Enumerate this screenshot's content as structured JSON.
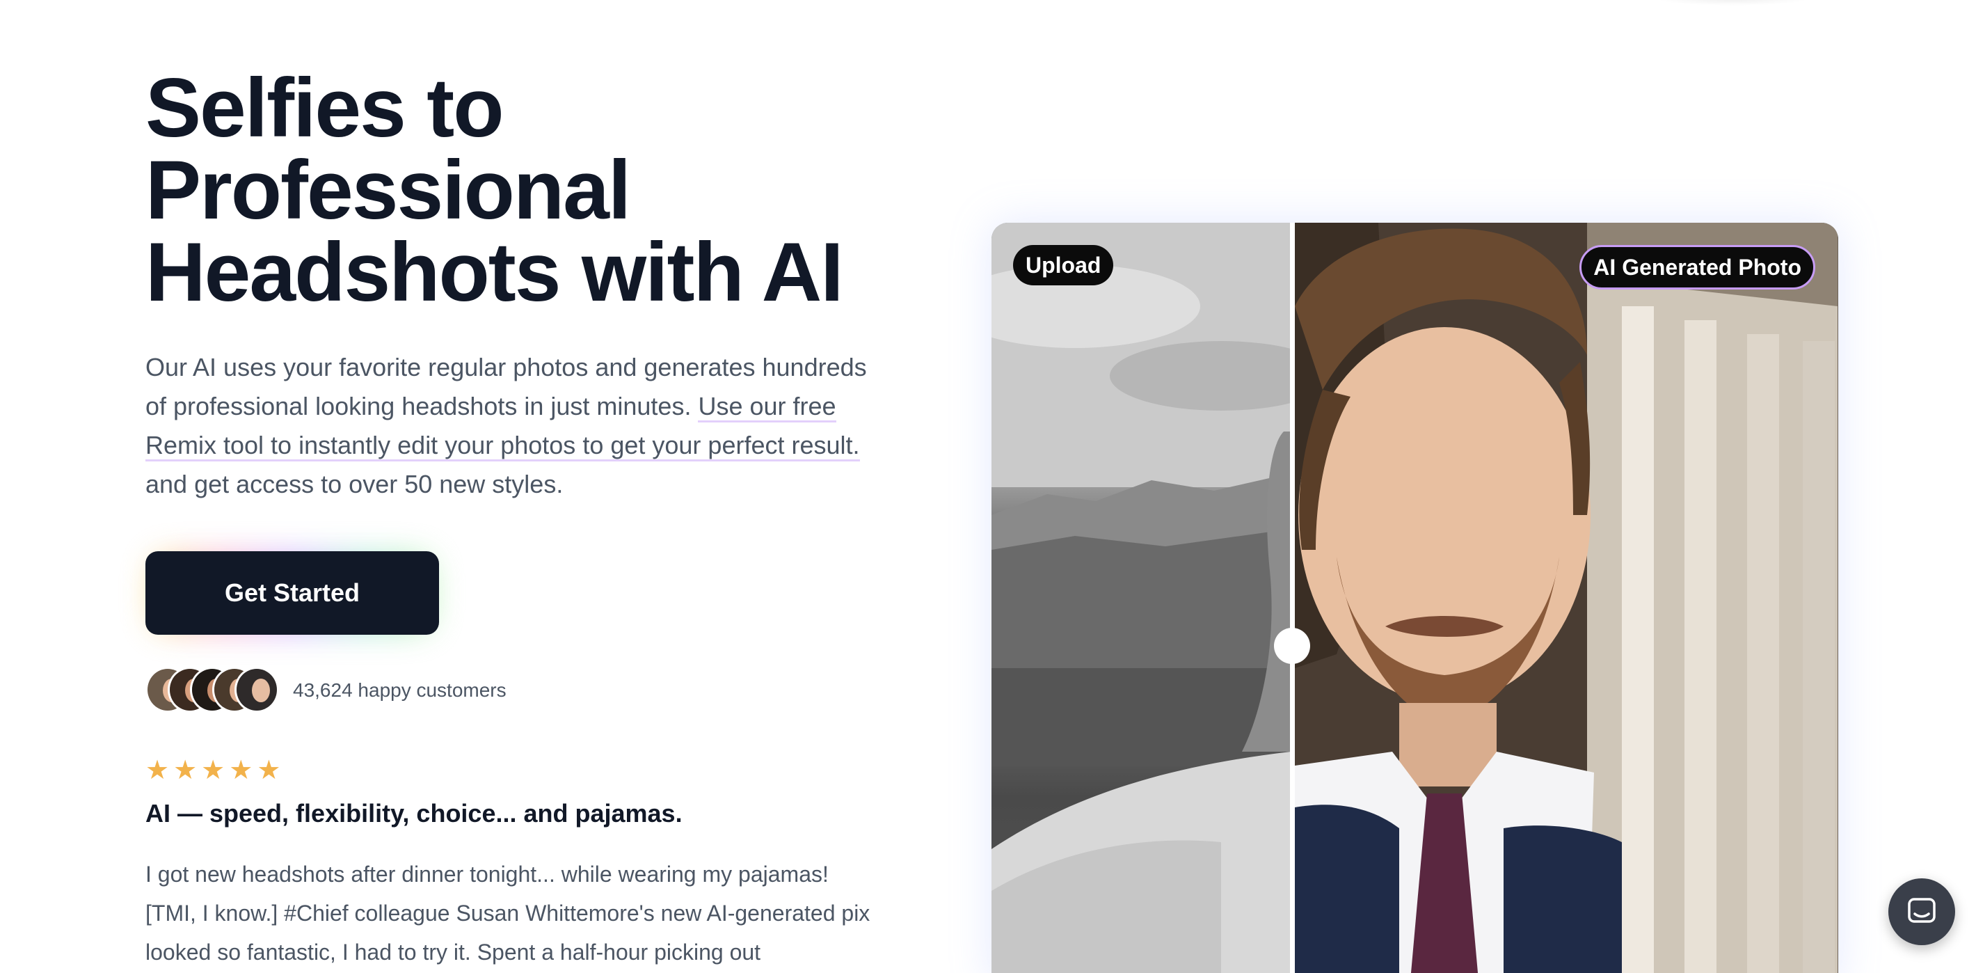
{
  "hero": {
    "title_lines": [
      "Selfies to",
      "Professional",
      "Headshots with AI"
    ],
    "description_intro": "Our AI uses your favorite regular photos and generates hundreds of professional looking headshots in just minutes. ",
    "description_link": "Use our free Remix tool to instantly edit your photos to get your perfect result.",
    "description_outro": " and get access to over 50 new styles.",
    "cta_label": "Get Started"
  },
  "social_proof": {
    "customers_text": "43,624 happy customers",
    "rating": 5,
    "stars": [
      "★",
      "★",
      "★",
      "★",
      "★"
    ]
  },
  "review": {
    "title": "AI — speed, flexibility, choice... and pajamas.",
    "body": "I got new headshots after dinner tonight... while wearing my pajamas! [TMI, I know.] #Chief colleague Susan Whittemore's new AI-generated pix looked so fantastic, I had to try it. Spent a half-hour picking out"
  },
  "comparison": {
    "left_label": "Upload",
    "right_label": "AI Generated Photo",
    "slider_position": 0.355
  },
  "colors": {
    "text_dark": "#111827",
    "text_muted": "#4b5563",
    "cta_bg": "#111827",
    "star": "#f2b24b",
    "link_underline": "#e3d0fb",
    "ai_badge_border": "#c79cf5"
  },
  "icons": {
    "chat": "chat-bubble-icon",
    "star": "star-icon"
  }
}
